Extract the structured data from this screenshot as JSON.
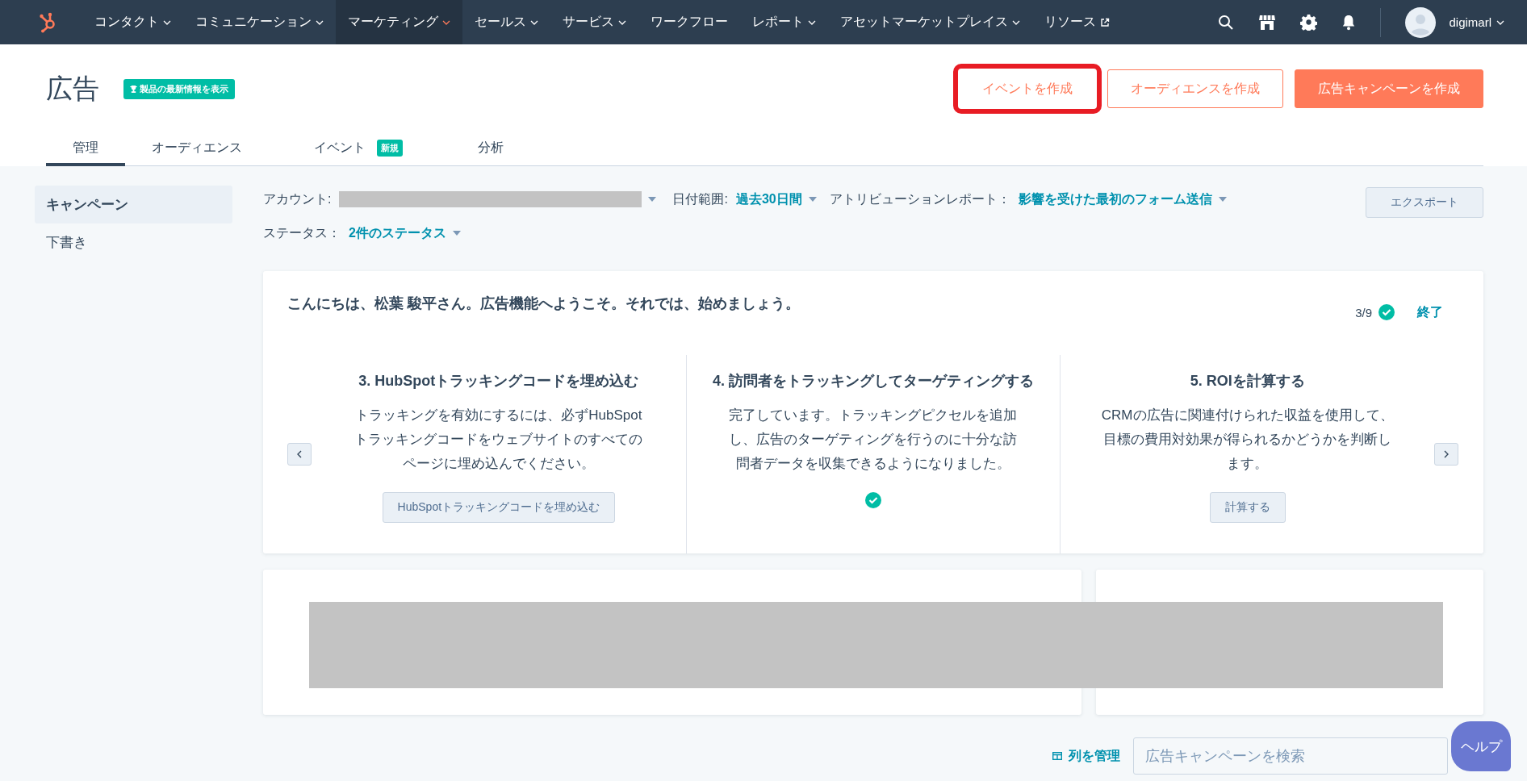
{
  "nav": {
    "items": [
      {
        "label": "コンタクト",
        "kind": "dropdown",
        "selected": false
      },
      {
        "label": "コミュニケーション",
        "kind": "dropdown",
        "selected": false
      },
      {
        "label": "マーケティング",
        "kind": "dropdown",
        "selected": true
      },
      {
        "label": "セールス",
        "kind": "dropdown",
        "selected": false
      },
      {
        "label": "サービス",
        "kind": "dropdown",
        "selected": false
      },
      {
        "label": "ワークフロー",
        "kind": "link",
        "selected": false
      },
      {
        "label": "レポート",
        "kind": "dropdown",
        "selected": false
      },
      {
        "label": "アセットマーケットプレイス",
        "kind": "dropdown",
        "selected": false
      },
      {
        "label": "リソース",
        "kind": "external",
        "selected": false
      }
    ],
    "user": {
      "name": "digimarl"
    }
  },
  "header": {
    "title": "広告",
    "badge": "製品の最新情報を表示",
    "buttons": [
      {
        "label": "イベントを作成",
        "kind": "plain",
        "highlighted": true
      },
      {
        "label": "オーディエンスを作成",
        "kind": "secondary",
        "highlighted": false
      },
      {
        "label": "広告キャンペーンを作成",
        "kind": "primary",
        "highlighted": false
      }
    ]
  },
  "tabs": [
    {
      "label": "管理",
      "selected": true
    },
    {
      "label": "オーディエンス",
      "selected": false
    },
    {
      "label": "イベント",
      "badge": "新規",
      "selected": false
    },
    {
      "label": "分析",
      "selected": false
    }
  ],
  "sidebar": {
    "items": [
      {
        "label": "キャンペーン",
        "selected": true
      },
      {
        "label": "下書き",
        "selected": false
      }
    ]
  },
  "filters": {
    "account": {
      "label": "アカウント:"
    },
    "date_range": {
      "label": "日付範囲:",
      "value": "過去30日間"
    },
    "attribution": {
      "label": "アトリビューションレポート：",
      "value": "影響を受けた最初のフォーム送信"
    },
    "status": {
      "label": "ステータス：",
      "value": "2件のステータス"
    },
    "export_button": "エクスポート"
  },
  "onboarding": {
    "greeting": "こんにちは、松葉 駿平さん。広告機能へようこそ。それでは、始めましょう。",
    "progress": "3/9",
    "finish": "終了",
    "steps": [
      {
        "title": "3. HubSpotトラッキングコードを埋め込む",
        "description": "トラッキングを有効にするには、必ずHubSpotトラッキングコードをウェブサイトのすべてのページに埋め込んでください。",
        "action": "HubSpotトラッキングコードを埋め込む",
        "completed": false
      },
      {
        "title": "4. 訪問者をトラッキングしてターゲティングする",
        "description": "完了しています。トラッキングピクセルを追加し、広告のターゲティングを行うのに十分な訪問者データを収集できるようになりました。",
        "completed": true
      },
      {
        "title": "5. ROIを計算する",
        "description": "CRMの広告に関連付けられた収益を使用して、目標の費用対効果が得られるかどうかを判断します。",
        "action": "計算する",
        "completed": false
      }
    ]
  },
  "toolbar": {
    "manage_columns": "列を管理",
    "search": {
      "placeholder": "広告キャンペーンを検索"
    }
  },
  "help": "ヘルプ"
}
